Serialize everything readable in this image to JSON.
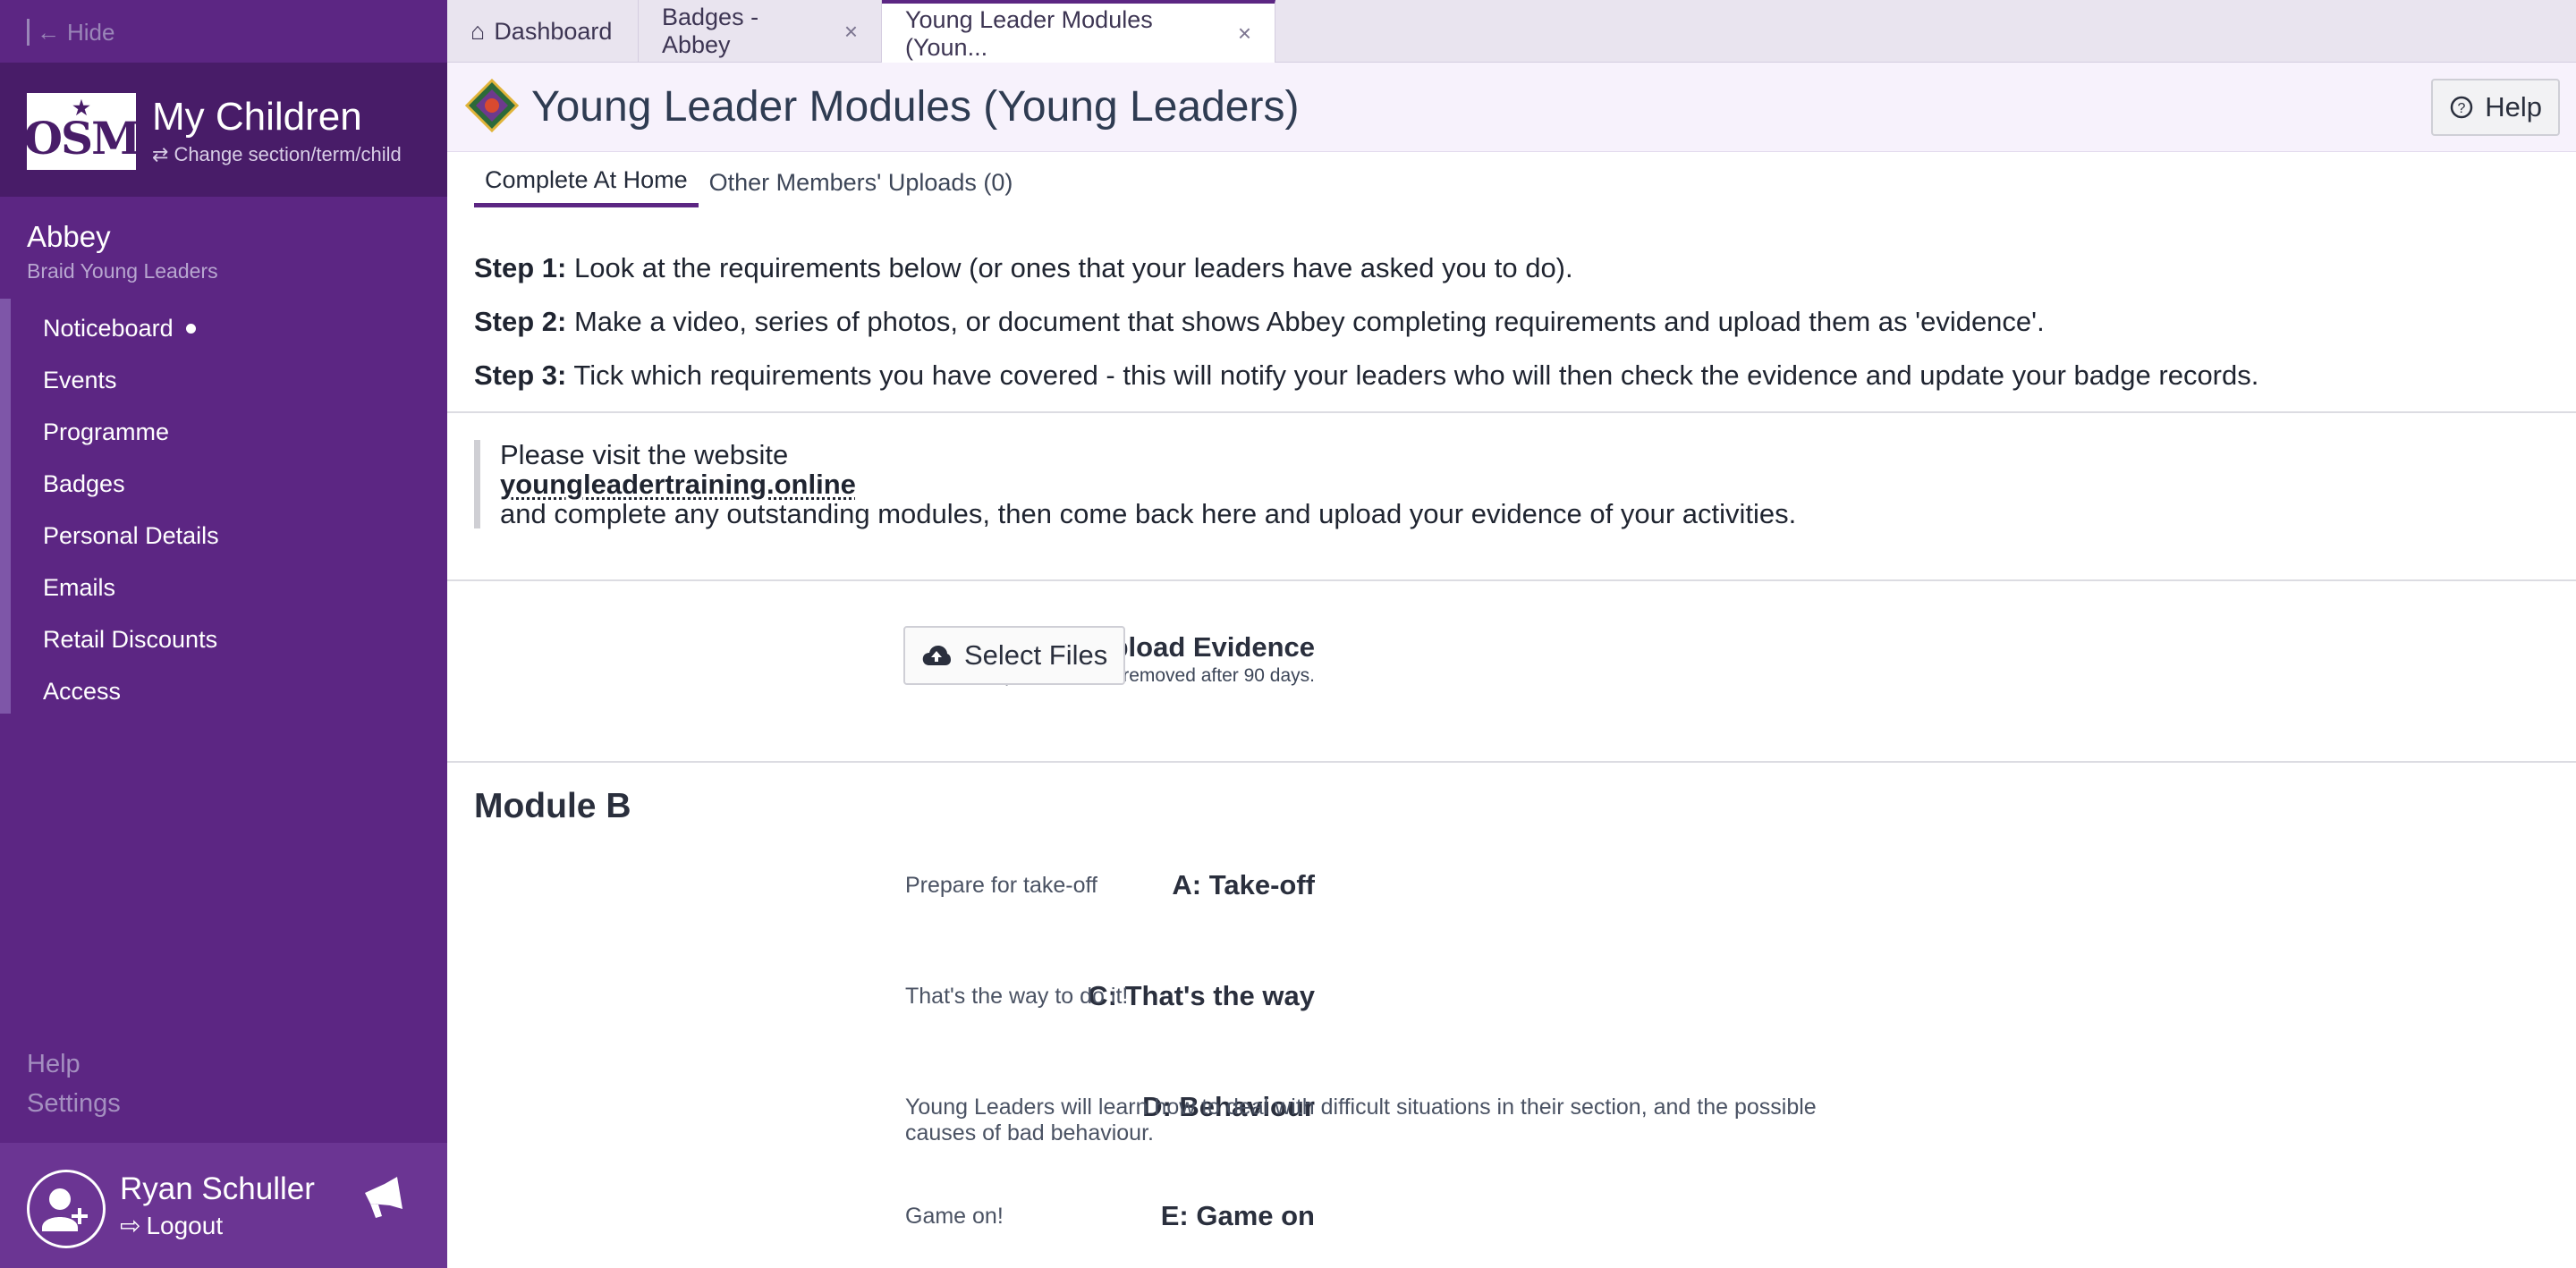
{
  "sidebar": {
    "hide_label": "Hide",
    "app_title": "My Children",
    "change_label": "Change section/term/child",
    "logo_text": "OSM",
    "child_name": "Abbey",
    "child_section": "Braid Young Leaders",
    "nav": [
      {
        "label": "Noticeboard",
        "has_dot": true
      },
      {
        "label": "Events"
      },
      {
        "label": "Programme"
      },
      {
        "label": "Badges"
      },
      {
        "label": "Personal Details"
      },
      {
        "label": "Emails"
      },
      {
        "label": "Retail Discounts"
      },
      {
        "label": "Access"
      }
    ],
    "help_label": "Help",
    "settings_label": "Settings",
    "user_name": "Ryan Schuller",
    "logout_label": "Logout"
  },
  "tabs": [
    {
      "label": "Dashboard",
      "icon": "home-icon"
    },
    {
      "label": "Badges - Abbey",
      "closable": true
    },
    {
      "label": "Young Leader Modules (Youn...",
      "closable": true,
      "active": true
    }
  ],
  "header": {
    "title": "Young Leader Modules (Young Leaders)",
    "help_label": "Help"
  },
  "subtabs": [
    {
      "label": "Complete At Home",
      "active": true
    },
    {
      "label": "Other Members' Uploads (0)"
    }
  ],
  "steps": [
    {
      "label": "Step 1:",
      "text": " Look at the requirements below (or ones that your leaders have asked you to do)."
    },
    {
      "label": "Step 2:",
      "text": " Make a video, series of photos, or document that shows Abbey completing requirements and upload them as 'evidence'."
    },
    {
      "label": "Step 3:",
      "text": " Tick which requirements you have covered - this will notify your leaders who will then check the evidence and update your badge records."
    }
  ],
  "notice": {
    "line1": "Please visit the website",
    "link": "youngleadertraining.online",
    "line3": "and complete any outstanding modules, then come back here and upload your evidence of your activities."
  },
  "upload": {
    "title": "Upload Evidence",
    "note": "Uploads will be removed after 90 days.",
    "button_label": "Select Files"
  },
  "module": {
    "title": "Module B",
    "requirements": [
      {
        "label": "A: Take-off",
        "description": "Prepare for take-off"
      },
      {
        "label": "C: That's the way",
        "description": "That's the way to do it!"
      },
      {
        "label": "D: Behaviour",
        "description": "Young Leaders will learn how to deal with difficult situations in their section, and the possible causes of bad behaviour."
      },
      {
        "label": "E: Game on",
        "description": "Game on!"
      }
    ]
  },
  "colors": {
    "sidebar": "#5c2683",
    "sidebar_header": "#481c68",
    "accent": "#5c2683"
  }
}
